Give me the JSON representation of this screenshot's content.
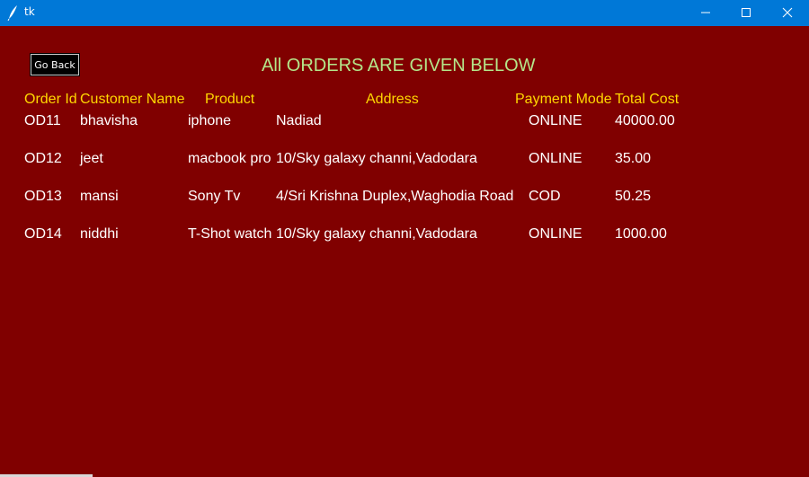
{
  "window": {
    "title": "tk"
  },
  "go_back_label": "Go Back",
  "heading": "All ORDERS ARE GIVEN BELOW",
  "columns": [
    "Order Id",
    "Customer Name",
    "Product",
    "Address",
    "Payment Mode",
    "Total Cost"
  ],
  "rows": [
    [
      "OD11",
      "bhavisha",
      "iphone",
      "Nadiad",
      "ONLINE",
      "40000.00"
    ],
    [
      "OD12",
      "jeet",
      "macbook pro",
      "10/Sky galaxy channi,Vadodara",
      "ONLINE",
      "35.00"
    ],
    [
      "OD13",
      "mansi",
      "Sony Tv",
      "4/Sri Krishna Duplex,Waghodia Road",
      "COD",
      "50.25"
    ],
    [
      "OD14",
      "niddhi",
      "T-Shot watch",
      "10/Sky galaxy channi,Vadodara",
      "ONLINE",
      "1000.00"
    ]
  ],
  "colors": {
    "background": "#800000",
    "header_text": "#ffd700",
    "heading_text": "#b5e68a",
    "cell_text": "#ffffff",
    "titlebar": "#0078d7"
  },
  "icons": {
    "app": "tk-feather-icon",
    "minimize": "minimize-icon",
    "maximize": "maximize-icon",
    "close": "close-icon"
  }
}
